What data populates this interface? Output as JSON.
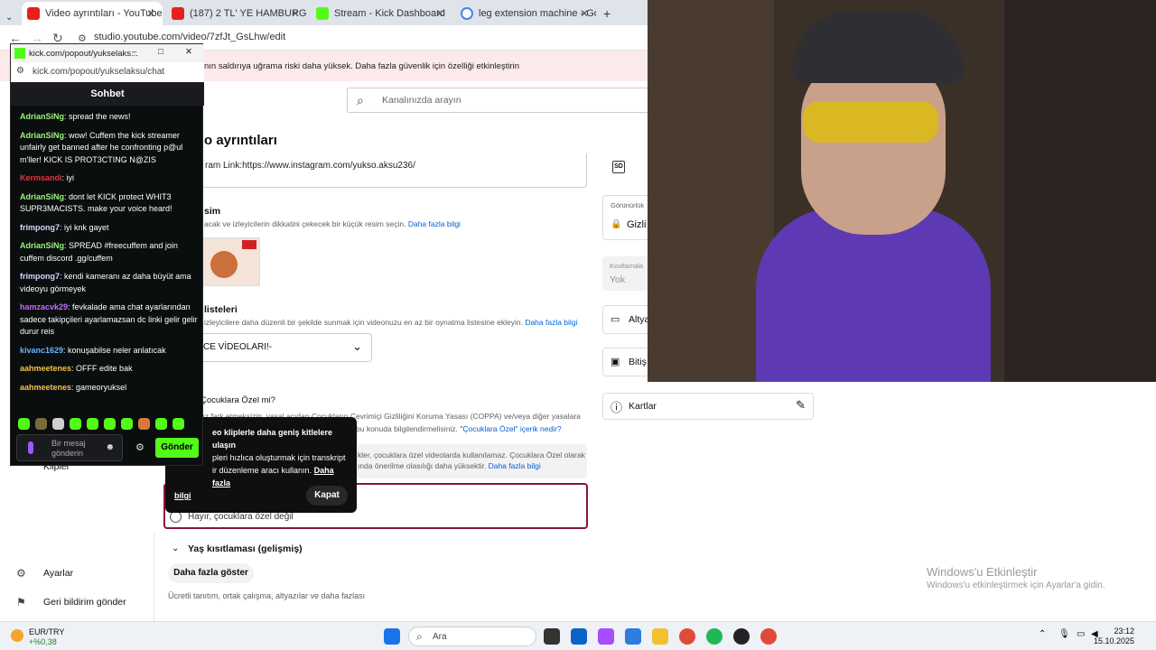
{
  "tabs": [
    {
      "title": "Video ayrıntıları - YouTube Stu"
    },
    {
      "title": "(187) 2 TL' YE HAMBURGER YA"
    },
    {
      "title": "Stream - Kick Dashboard"
    },
    {
      "title": "leg extension machine - Google"
    }
  ],
  "address": {
    "url": "studio.youtube.com/video/7zfJt_GsLhw/edit"
  },
  "banner": {
    "text": "nın saldırıya uğrama riski daha yüksek. Daha fazla güvenlik için özelliği etkinleştirin"
  },
  "search": {
    "placeholder": "Kanalınızda arayın"
  },
  "page": {
    "title": "o ayrıntıları",
    "link_text": "ram Link:https://www.instagram.com/yukso.aksu236/",
    "thumb_title": "sim",
    "thumb_desc": "acak ve izleyicilerin dikkatini çekecek bir küçük resim seçin.",
    "more_info": "Daha fazla bilgi",
    "playlists_title": "listeleri",
    "playlists_desc": "izleyicilere daha düzenli bir şekilde sunmak için videonuzu en az bir oynatma listesine ekleyin.",
    "playlist_value": "CE VİDEOLARI!-",
    "kids_title": "Çocuklara Özel mi?",
    "kids_desc1": "uz fark etmeksizin, yasal açıdan Çocukların Çevrimiçi Gizliliğini Koruma Yasası (COPPA) ve/veya diğer yasalara",
    "kids_desc2": "bu konuda bilgilendirmelisiniz.",
    "kids_link": "\"Çocuklara Özel\" içerik nedir?",
    "coppa_line1": "kler, çocuklara özel videolarda kullanılamaz. Çocuklara Özel olarak",
    "coppa_line2": "ında önerilme olasılığı daha yüksektir.",
    "no_kids": "Hayır, çocuklara özel değil",
    "age": "Yaş kısıtlaması (gelişmiş)",
    "show_more": "Daha fazla göster",
    "paid_text": "Ücretli tanıtım, ortak çalışma, altyazılar ve daha fazlası",
    "nav_klipler": "Klipler",
    "nav_settings": "Ayarlar",
    "nav_feedback": "Geri bildirim gönder",
    "right_visibility_label": "Görünürlük",
    "right_visibility": "Gizli",
    "right_restrictions_label": "Kısıtlamala",
    "right_restrictions": "Yok",
    "right_subs": "Altya",
    "right_end": "Bitiş",
    "cards": "Kartlar"
  },
  "tooltip": {
    "line1": "eo kliplerle daha geniş kitlelere ulaşın",
    "line2": "pleri hızlıca oluşturmak için transkript",
    "line3": "ir düzenleme aracı kullanın.",
    "link_a": "Daha fazla",
    "link_b": "bilgi",
    "close": "Kapat"
  },
  "kick": {
    "window_title": "kick.com/popout/yukselaks...",
    "url": "kick.com/popout/yukselaksu/chat",
    "header": "Sohbet",
    "messages": [
      {
        "user": "AdrianSiNg",
        "color": "#9cf37c",
        "text": "spread the news!"
      },
      {
        "user": "AdrianSiNg",
        "color": "#9cf37c",
        "text": "wow! Cuffem the kick streamer unfairly get banned after he confronting p@ul m'ller! KICK IS PROT3CTING N@ZIS"
      },
      {
        "user": "Kermsandi",
        "color": "#e0343e",
        "text": "iyi"
      },
      {
        "user": "AdrianSiNg",
        "color": "#9cf37c",
        "text": "dont let KICK protect WHIT3 SUPR3MACISTS. make your voice heard!"
      },
      {
        "user": "frimpong7",
        "color": "#d7d7ff",
        "text": "iyi knk gayet"
      },
      {
        "user": "AdrianSiNg",
        "color": "#9cf37c",
        "text": "SPREAD #freecuffem and join cuffem discord .gg/cuffem"
      },
      {
        "user": "frimpong7",
        "color": "#d7d7ff",
        "text": "kendi kameranı az daha büyüt ama videoyu görmeyek"
      },
      {
        "user": "hamzacvk29",
        "color": "#c46bff",
        "text": "fevkalade ama chat ayarlarından sadece takipçileri ayarlamazsan dc linki gelir gelir durur reis"
      },
      {
        "user": "kivanc1629",
        "color": "#6cb4ff",
        "text": "konuşabilse neler anlatıcak"
      },
      {
        "user": "aahmeetenes",
        "color": "#f3c24b",
        "text": "OFFF edite bak"
      },
      {
        "user": "aahmeetenes",
        "color": "#f3c24b",
        "text": "gameoryuksel"
      }
    ],
    "input_placeholder": "Bir mesaj gönderin",
    "send": "Gönder"
  },
  "watermark": {
    "title": "Windows'u Etkinleştir",
    "sub": "Windows'u etkinleştirmek için Ayarlar'a gidin."
  },
  "taskbar": {
    "ticker": "EUR/TRY",
    "ticker_change": "+%0,38",
    "search": "Ara",
    "time": "23:12",
    "date": "15.10.2025"
  }
}
